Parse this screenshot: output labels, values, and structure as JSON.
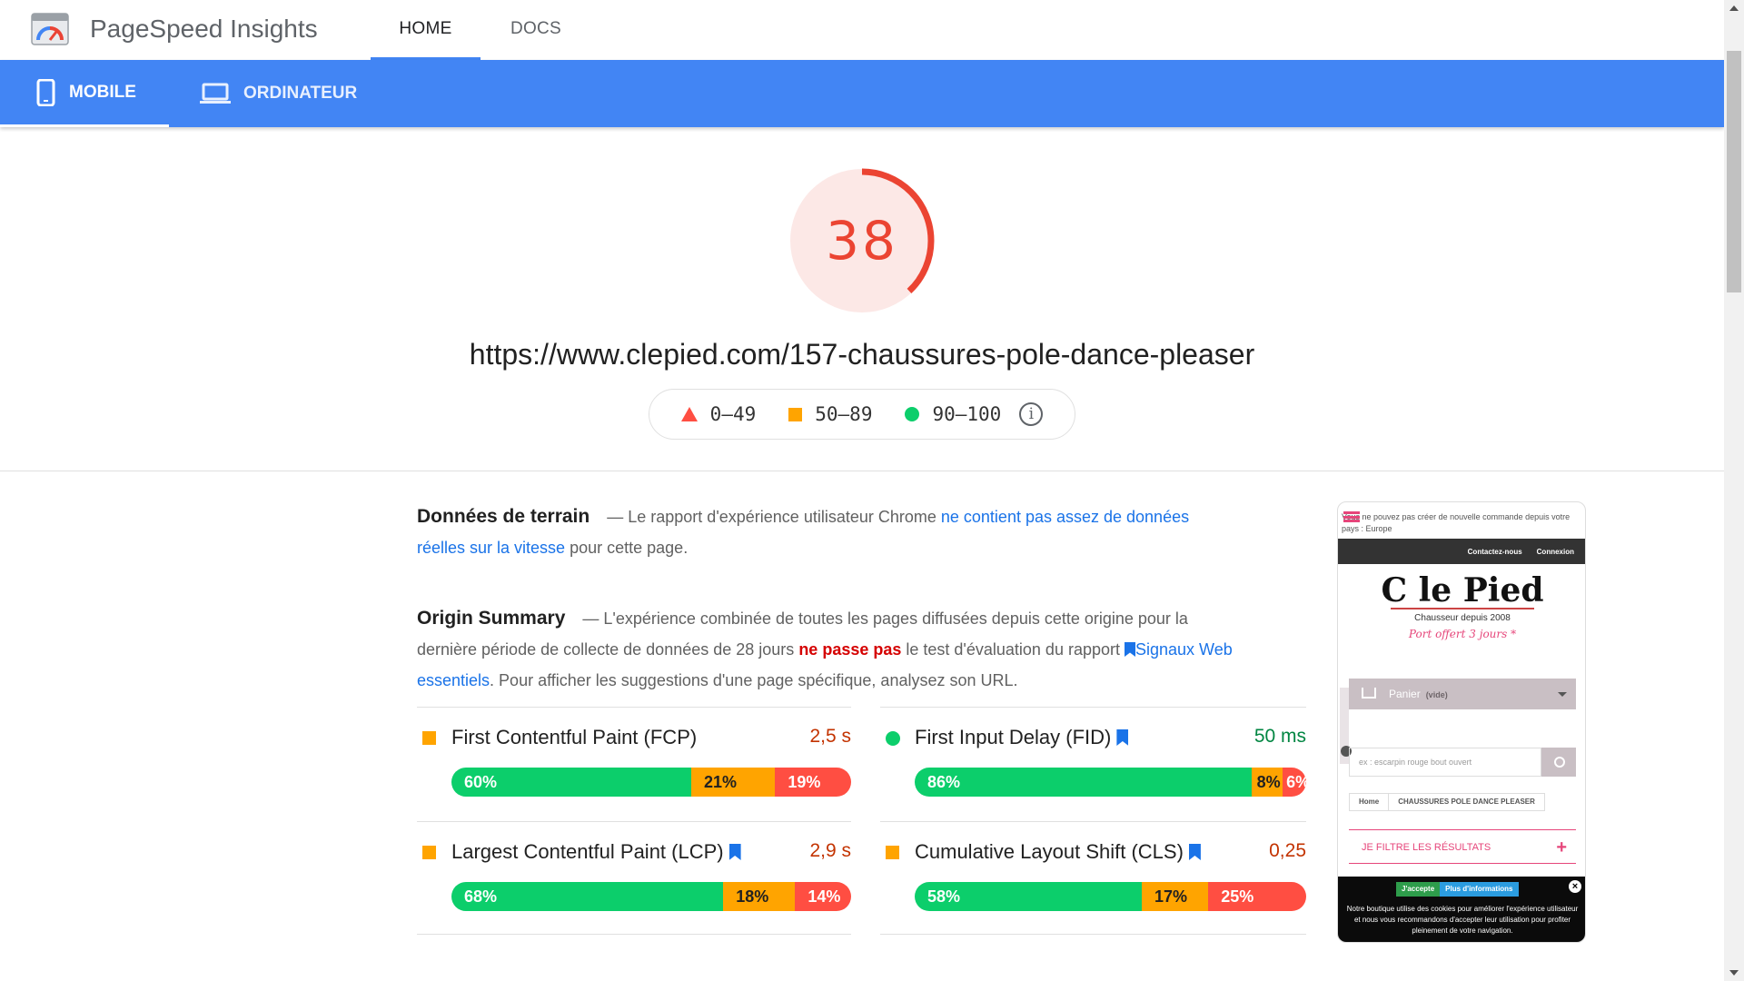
{
  "header": {
    "app_title": "PageSpeed Insights",
    "tabs": [
      {
        "label": "HOME"
      },
      {
        "label": "DOCS"
      }
    ]
  },
  "device_tabs": [
    {
      "label": "MOBILE"
    },
    {
      "label": "ORDINATEUR"
    }
  ],
  "score": {
    "value": "38",
    "fraction": 0.38,
    "color": "#eb4432"
  },
  "url": "https://www.clepied.com/157-chaussures-pole-dance-pleaser",
  "legend": [
    {
      "label": "0–49"
    },
    {
      "label": "50–89"
    },
    {
      "label": "90–100"
    }
  ],
  "field_data": {
    "title": "Données de terrain",
    "text_1": "— Le rapport d'expérience utilisateur Chrome",
    "link": "ne contient pas assez de données réelles sur la vitesse",
    "text_2": "pour cette page."
  },
  "origin_summary": {
    "title": "Origin Summary",
    "text_1": "— L'expérience combinée de toutes les pages diffusées depuis cette origine pour la dernière période de collecte de données de 28 jours",
    "verdict": "ne passe pas",
    "text_2": "le test d'évaluation du rapport",
    "link": "Signaux Web essentiels",
    "text_3": ". Pour afficher les suggestions d'une page spécifique, analysez son URL."
  },
  "metrics": [
    {
      "name": "First Contentful Paint (FCP)",
      "value": "2,5 s",
      "value_color": "#c33300",
      "indicator": "square",
      "bookmark": false,
      "dist": [
        "60%",
        "21%",
        "19%"
      ],
      "dist_values": [
        60,
        21,
        19
      ]
    },
    {
      "name": "First Input Delay (FID)",
      "value": "50 ms",
      "value_color": "#018642",
      "indicator": "circle",
      "bookmark": true,
      "dist": [
        "86%",
        "8%",
        "6%"
      ],
      "dist_values": [
        86,
        8,
        6
      ]
    },
    {
      "name": "Largest Contentful Paint (LCP)",
      "value": "2,9 s",
      "value_color": "#c33300",
      "indicator": "square",
      "bookmark": true,
      "dist": [
        "68%",
        "18%",
        "14%"
      ],
      "dist_values": [
        68,
        18,
        14
      ]
    },
    {
      "name": "Cumulative Layout Shift (CLS)",
      "value": "0,25",
      "value_color": "#c33300",
      "indicator": "square",
      "bookmark": true,
      "dist": [
        "58%",
        "17%",
        "25%"
      ],
      "dist_values": [
        58,
        17,
        25
      ]
    }
  ],
  "colors": {
    "brand_blue": "#4285f4",
    "good": "#0cce6b",
    "average": "#ffa400",
    "poor": "#ff4e42",
    "link": "#1a73e8"
  },
  "phone_preview": {
    "notice": "Vous ne pouvez pas créer de nouvelle commande depuis votre pays : Europe",
    "top_links": [
      "Contactez-nous",
      "Connexion"
    ],
    "logo": "C le Pied",
    "tagline": "Chausseur depuis 2008",
    "shipping": "Port offert 3 jours *",
    "cart": "Panier",
    "cart_state": "(vide)",
    "search_placeholder": "ex : escarpin rouge bout ouvert",
    "breadcrumb": [
      "Home",
      "CHAUSSURES POLE DANCE PLEASER"
    ],
    "filter": "JE FILTRE LES RÉSULTATS",
    "cookie_accept": "J'accepte",
    "cookie_more": "Plus d'informations",
    "cookie_text": "Notre boutique utilise des cookies pour améliorer l'expérience utilisateur et nous vous recommandons d'accepter leur utilisation pour profiter pleinement de votre navigation."
  }
}
